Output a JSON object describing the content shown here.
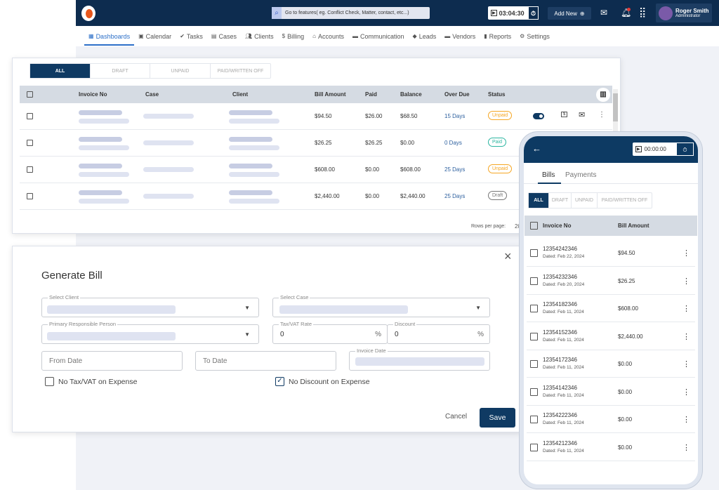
{
  "header": {
    "search_placeholder": "Go to features( eg. Conflict Check, Matter, contact, etc...)",
    "timer": "03:04:30",
    "add_new": "Add New",
    "user_name": "Roger Smith",
    "user_role": "Administrator"
  },
  "nav": [
    {
      "label": "Dashboards",
      "icon": "dashboard-icon",
      "active": true
    },
    {
      "label": "Calendar",
      "icon": "calendar-icon"
    },
    {
      "label": "Tasks",
      "icon": "check-circle-icon"
    },
    {
      "label": "Cases",
      "icon": "briefcase-icon"
    },
    {
      "label": "Clients",
      "icon": "people-icon"
    },
    {
      "label": "Billing",
      "icon": "dollar-icon"
    },
    {
      "label": "Accounts",
      "icon": "bank-icon"
    },
    {
      "label": "Communication",
      "icon": "chat-icon"
    },
    {
      "label": "Leads",
      "icon": "leads-icon"
    },
    {
      "label": "Vendors",
      "icon": "truck-icon"
    },
    {
      "label": "Reports",
      "icon": "report-icon"
    },
    {
      "label": "Settings",
      "icon": "settings-icon"
    }
  ],
  "invoices": {
    "filters": [
      "ALL",
      "DRAFT",
      "UNPAID",
      "PAID/WRITTEN OFF"
    ],
    "columns": [
      "Invoice No",
      "Case",
      "Client",
      "Bill Amount",
      "Paid",
      "Balance",
      "Over Due",
      "Status"
    ],
    "rows": [
      {
        "bill": "$94.50",
        "paid": "$26.00",
        "balance": "$68.50",
        "overdue": "15 Days",
        "status": "Unpaid"
      },
      {
        "bill": "$26.25",
        "paid": "$26.25",
        "balance": "$0.00",
        "overdue": "0 Days",
        "status": "Paid"
      },
      {
        "bill": "$608.00",
        "paid": "$0.00",
        "balance": "$608.00",
        "overdue": "25 Days",
        "status": "Unpaid"
      },
      {
        "bill": "$2,440.00",
        "paid": "$0.00",
        "balance": "$2,440.00",
        "overdue": "25 Days",
        "status": "Draft"
      }
    ],
    "rows_per_page_label": "Rows per page:",
    "rows_per_page": "20",
    "status_colors": {
      "Unpaid": "#f5a623",
      "Paid": "#2bb5a0",
      "Draft": "#777777"
    }
  },
  "generate_bill": {
    "title": "Generate Bill",
    "select_client": "Select Client",
    "select_case": "Select Case",
    "primary_person": "Primary Responsible Person",
    "tax_label": "Tax/VAT Rate",
    "tax_value": "0",
    "discount_label": "Discount",
    "discount_value": "0",
    "percent": "%",
    "from_date": "From Date",
    "to_date": "To Date",
    "invoice_date": "Invoice Date",
    "no_tax": "No Tax/VAT on Expense",
    "no_tax_checked": false,
    "no_discount": "No Discount on Expense",
    "no_discount_checked": true,
    "cancel": "Cancel",
    "save": "Save"
  },
  "mobile": {
    "timer": "00:00:00",
    "tabs": [
      "Bills",
      "Payments"
    ],
    "filters": [
      "ALL",
      "DRAFT",
      "UNPAID",
      "PAID/WRITTEN OFF"
    ],
    "columns": [
      "Invoice No",
      "Bill Amount"
    ],
    "rows": [
      {
        "no": "12354242346",
        "date": "Dated: Feb 22, 2024",
        "amount": "$94.50"
      },
      {
        "no": "12354232346",
        "date": "Dated: Feb 20, 2024",
        "amount": "$26.25"
      },
      {
        "no": "12354182346",
        "date": "Dated: Feb 11, 2024",
        "amount": "$608.00"
      },
      {
        "no": "12354152346",
        "date": "Dated: Feb 11, 2024",
        "amount": "$2,440.00"
      },
      {
        "no": "12354172346",
        "date": "Dated: Feb 11, 2024",
        "amount": "$0.00"
      },
      {
        "no": "12354142346",
        "date": "Dated: Feb 11, 2024",
        "amount": "$0.00"
      },
      {
        "no": "12354222346",
        "date": "Dated: Feb 11, 2024",
        "amount": "$0.00"
      },
      {
        "no": "12354212346",
        "date": "Dated: Feb 11, 2024",
        "amount": "$0.00"
      }
    ]
  }
}
